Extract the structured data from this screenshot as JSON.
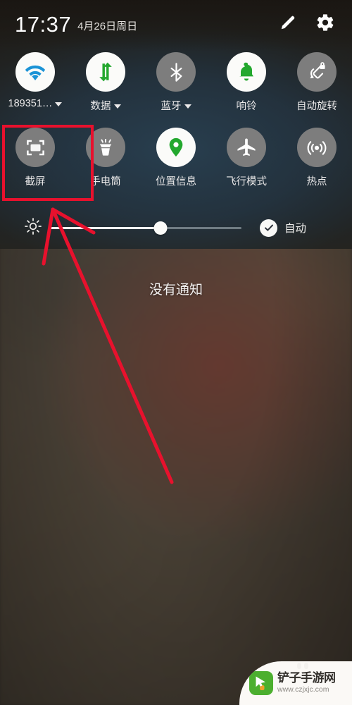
{
  "status_bar": {
    "time": "17:37",
    "date": "4月26日周日",
    "edit_icon": "pencil-icon",
    "settings_icon": "gear-icon"
  },
  "quick_settings": {
    "rows": [
      [
        {
          "label": "189351…",
          "icon": "wifi-icon",
          "state": "on",
          "has_caret": true
        },
        {
          "label": "数据",
          "icon": "mobile-data-icon",
          "state": "on",
          "has_caret": true
        },
        {
          "label": "蓝牙",
          "icon": "bluetooth-icon",
          "state": "off",
          "has_caret": true
        },
        {
          "label": "响铃",
          "icon": "bell-icon",
          "state": "on",
          "has_caret": false
        },
        {
          "label": "自动旋转",
          "icon": "auto-rotate-lock-icon",
          "state": "off",
          "has_caret": false
        }
      ],
      [
        {
          "label": "截屏",
          "icon": "screenshot-icon",
          "state": "off",
          "has_caret": false
        },
        {
          "label": "手电筒",
          "icon": "flashlight-icon",
          "state": "off",
          "has_caret": false
        },
        {
          "label": "位置信息",
          "icon": "location-pin-icon",
          "state": "on",
          "has_caret": false
        },
        {
          "label": "飞行模式",
          "icon": "airplane-icon",
          "state": "off",
          "has_caret": false
        },
        {
          "label": "热点",
          "icon": "hotspot-icon",
          "state": "off",
          "has_caret": false
        }
      ]
    ]
  },
  "brightness": {
    "icon": "brightness-sun-icon",
    "value_percent": 58,
    "auto_label": "自动",
    "auto_checked": true,
    "check_icon": "check-circle-icon"
  },
  "notifications": {
    "empty_text": "没有通知"
  },
  "annotation": {
    "highlight_target": "截屏",
    "highlight_color": "#e8112d",
    "arrow_color": "#e8112d"
  },
  "watermark": {
    "title": "铲子手游网",
    "url": "www.czjxjc.com",
    "logo_icon": "cursor-arrow-logo",
    "logo_color": "#4caf2f"
  }
}
